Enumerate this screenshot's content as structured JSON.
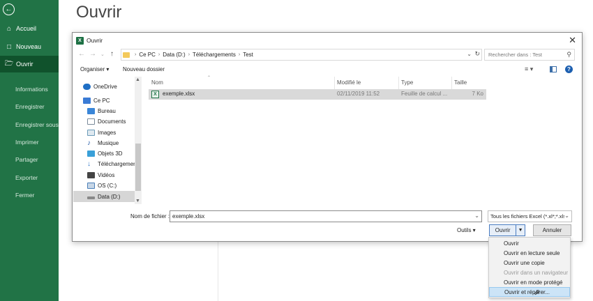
{
  "sidebar": {
    "items": [
      {
        "label": "Accueil"
      },
      {
        "label": "Nouveau"
      },
      {
        "label": "Ouvrir"
      },
      {
        "label": "Informations"
      },
      {
        "label": "Enregistrer"
      },
      {
        "label": "Enregistrer sous"
      },
      {
        "label": "Imprimer"
      },
      {
        "label": "Partager"
      },
      {
        "label": "Exporter"
      },
      {
        "label": "Fermer"
      }
    ]
  },
  "page_title": "Ouvrir",
  "dialog": {
    "title": "Ouvrir",
    "breadcrumb": [
      "Ce PC",
      "Data (D:)",
      "Téléchargements",
      "Test"
    ],
    "search_placeholder": "Rechercher dans : Test",
    "toolbar": {
      "organize": "Organiser ▾",
      "new_folder": "Nouveau dossier"
    },
    "nav": [
      {
        "label": "OneDrive",
        "color": "#1f6fc5"
      },
      {
        "label": "Ce PC",
        "color": "#3a7bd5"
      },
      {
        "label": "Bureau",
        "color": "#3a86d8"
      },
      {
        "label": "Documents",
        "color": "#7a8a99"
      },
      {
        "label": "Images",
        "color": "#6a9ab8"
      },
      {
        "label": "Musique",
        "color": "#2a5fa8"
      },
      {
        "label": "Objets 3D",
        "color": "#3aa0d8"
      },
      {
        "label": "Téléchargements",
        "color": "#2b73c7"
      },
      {
        "label": "Vidéos",
        "color": "#444444"
      },
      {
        "label": "OS (C:)",
        "color": "#4a7fb8"
      },
      {
        "label": "Data (D:)",
        "color": "#666666"
      }
    ],
    "columns": {
      "name": "Nom",
      "modified": "Modifié le",
      "type": "Type",
      "size": "Taille"
    },
    "files": [
      {
        "name": "exemple.xlsx",
        "modified": "02/11/2019 11:52",
        "type": "Feuille de calcul ...",
        "size": "7 Ko"
      }
    ],
    "filename_label": "Nom de fichier :",
    "filename_value": "exemple.xlsx",
    "filetype": "Tous les fichiers Excel (*.xl*;*.xls",
    "tools": "Outils",
    "open_button": "Ouvrir",
    "cancel_button": "Annuler"
  },
  "open_menu": [
    {
      "label": "Ouvrir",
      "state": "normal"
    },
    {
      "label": "Ouvrir en lecture seule",
      "state": "normal"
    },
    {
      "label": "Ouvrir une copie",
      "state": "normal"
    },
    {
      "label": "Ouvrir dans un navigateur",
      "state": "disabled"
    },
    {
      "label": "Ouvrir en mode protégé",
      "state": "normal"
    },
    {
      "label": "Ouvrir et réparer...",
      "state": "hover"
    }
  ],
  "colors": {
    "excel_green": "#217346",
    "active_item": "#10522c",
    "menu_hover": "#cce4f7"
  }
}
